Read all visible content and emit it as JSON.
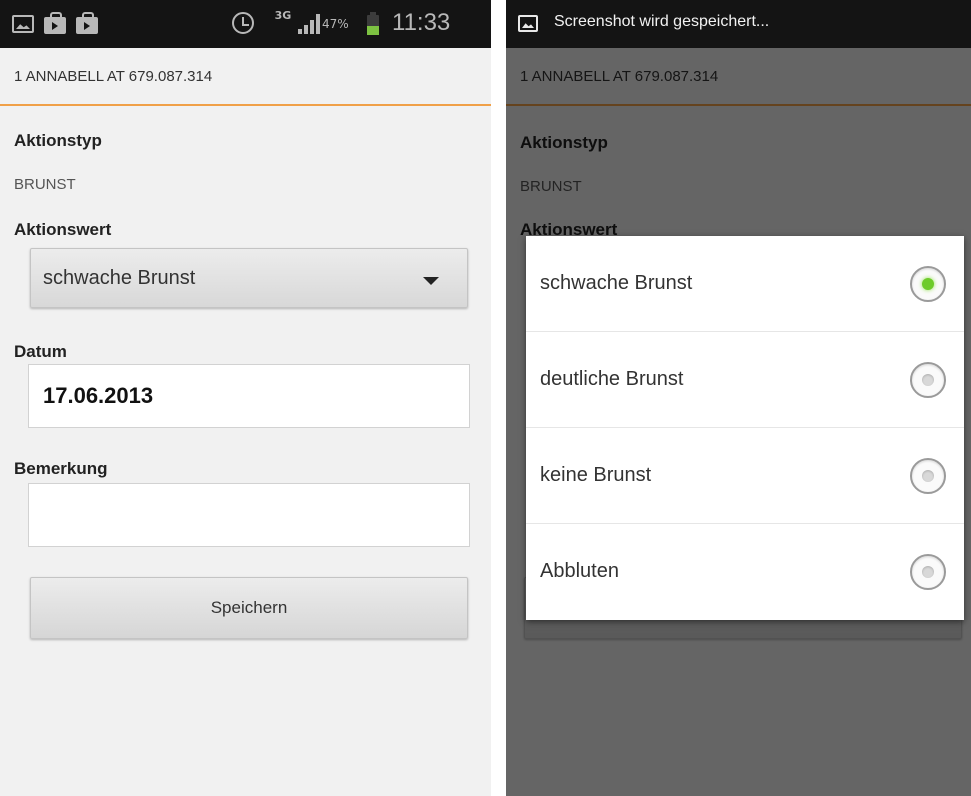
{
  "status_bar": {
    "network": "3G",
    "battery_percent": "47%",
    "battery_level": 0.47,
    "time": "11:33"
  },
  "notification": {
    "text": "Screenshot wird gespeichert..."
  },
  "header": {
    "title": "1 ANNABELL AT 679.087.314"
  },
  "form": {
    "action_type_label": "Aktionstyp",
    "action_type_value": "BRUNST",
    "action_value_label": "Aktionswert",
    "action_value_selected": "schwache Brunst",
    "date_label": "Datum",
    "date_value": "17.06.2013",
    "remark_label": "Bemerkung",
    "remark_value": "",
    "save_label": "Speichern"
  },
  "dialog": {
    "options": [
      {
        "label": "schwache Brunst",
        "selected": true
      },
      {
        "label": "deutliche Brunst",
        "selected": false
      },
      {
        "label": "keine Brunst",
        "selected": false
      },
      {
        "label": "Abbluten",
        "selected": false
      }
    ]
  },
  "colors": {
    "accent": "#f0a048",
    "radio_selected": "#6ecb2a"
  },
  "icons": [
    "image-icon",
    "shopping-bag-icon",
    "alarm-clock-icon",
    "signal-icon",
    "battery-icon",
    "dropdown-arrow-icon",
    "radio-icon"
  ]
}
